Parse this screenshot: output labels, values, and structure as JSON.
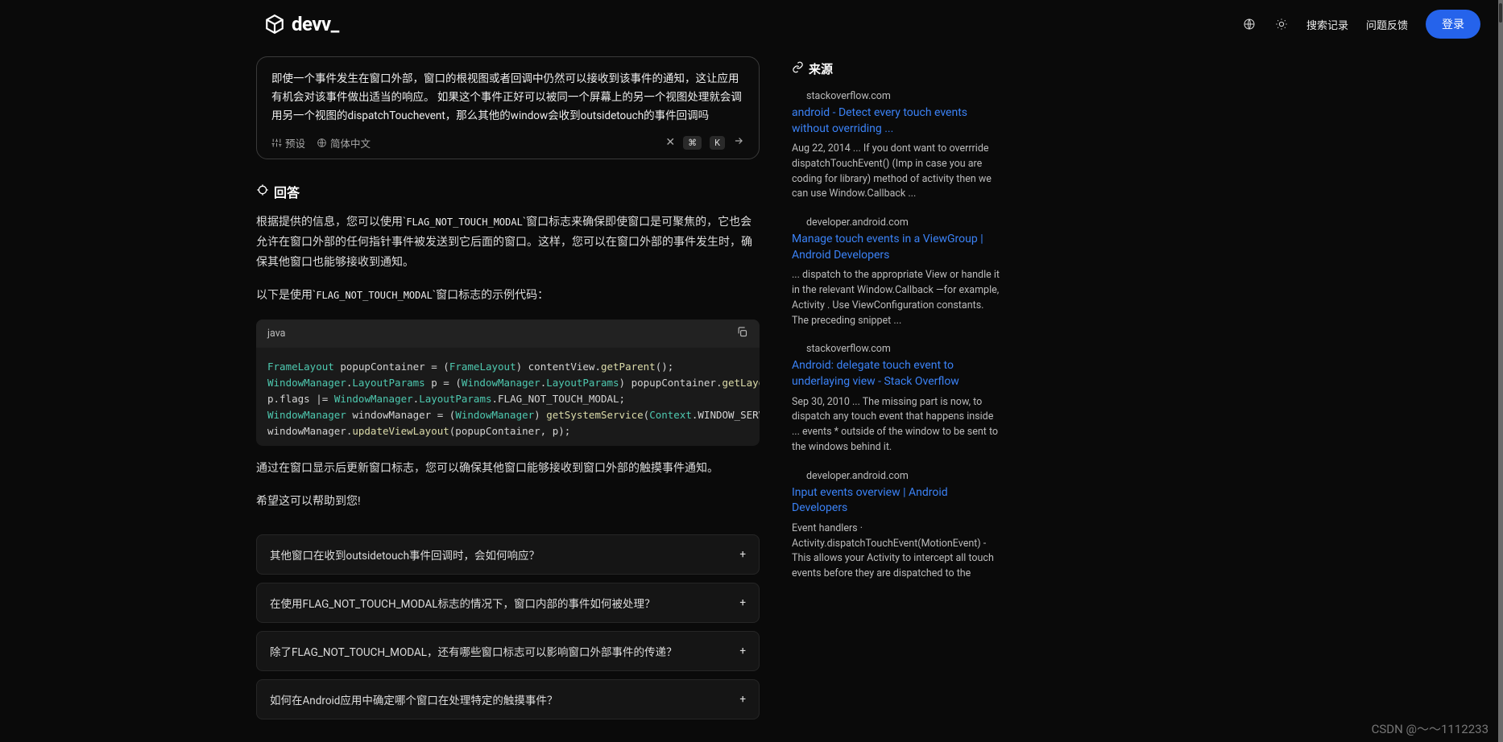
{
  "header": {
    "logo_text": "devv_",
    "nav": {
      "history": "搜索记录",
      "feedback": "问题反馈",
      "login": "登录"
    }
  },
  "query": {
    "text": "即使一个事件发生在窗口外部，窗口的根视图或者回调中仍然可以接收到该事件的通知，这让应用有机会对该事件做出适当的响应。 如果这个事件正好可以被同一个屏幕上的另一个视图处理就会调用另一个视图的dispatchTouchevent，那么其他的window会收到outsidetouch的事件回调吗",
    "preset": "预设",
    "lang": "简体中文",
    "kbd1": "⌘",
    "kbd2": "K"
  },
  "answer": {
    "heading": "回答",
    "p1_pre": "根据提供的信息，您可以使用`",
    "p1_code": "FLAG_NOT_TOUCH_MODAL",
    "p1_post": "`窗口标志来确保即使窗口是可聚焦的，它也会允许在窗口外部的任何指针事件被发送到它后面的窗口。这样，您可以在窗口外部的事件发生时，确保其他窗口也能够接收到通知。",
    "p2_pre": "以下是使用`",
    "p2_code": "FLAG_NOT_TOUCH_MODAL",
    "p2_post": "`窗口标志的示例代码：",
    "code_lang": "java",
    "p3": "通过在窗口显示后更新窗口标志，您可以确保其他窗口能够接收到窗口外部的触摸事件通知。",
    "p4": "希望这可以帮助到您!"
  },
  "code": {
    "l1a": "FrameLayout",
    "l1b": " popupContainer ",
    "l1c": "=",
    "l1d": " (",
    "l1e": "FrameLayout",
    "l1f": ") contentView.",
    "l1g": "getParent",
    "l1h": "();",
    "l2a": "WindowManager",
    "l2b": ".",
    "l2c": "LayoutParams",
    "l2d": " p ",
    "l2e": "=",
    "l2f": " (",
    "l2g": "WindowManager",
    "l2h": ".",
    "l2i": "LayoutParams",
    "l2j": ") popupContainer.",
    "l2k": "getLayoutParams",
    "l2l": "();",
    "l3a": "p.flags ",
    "l3b": "|=",
    "l3c": " ",
    "l3d": "WindowManager",
    "l3e": ".",
    "l3f": "LayoutParams",
    "l3g": ".FLAG_NOT_TOUCH_MODAL;",
    "l4a": "WindowManager",
    "l4b": " windowManager ",
    "l4c": "=",
    "l4d": " (",
    "l4e": "WindowManager",
    "l4f": ") ",
    "l4g": "getSystemService",
    "l4h": "(",
    "l4i": "Context",
    "l4j": ".WINDOW_SERVICE);",
    "l5a": "windowManager.",
    "l5b": "updateViewLayout",
    "l5c": "(popupContainer, p);"
  },
  "followups": [
    "其他窗口在收到outsidetouch事件回调时，会如何响应？",
    "在使用FLAG_NOT_TOUCH_MODAL标志的情况下，窗口内部的事件如何被处理？",
    "除了FLAG_NOT_TOUCH_MODAL，还有哪些窗口标志可以影响窗口外部事件的传递？",
    "如何在Android应用中确定哪个窗口在处理特定的触摸事件？"
  ],
  "sources": {
    "heading": "来源",
    "items": [
      {
        "domain": "stackoverflow.com",
        "title": "android - Detect every touch events without overriding ...",
        "snippet": "Aug 22, 2014 ... If you dont want to overrride dispatchTouchEvent() (Imp in case you are coding for library) method of activity then we can use Window.Callback ..."
      },
      {
        "domain": "developer.android.com",
        "title": "Manage touch events in a ViewGroup | Android Developers",
        "snippet": "... dispatch to the appropriate View or handle it in the relevant Window.Callback —for example, Activity . Use ViewConfiguration constants. The preceding snippet ..."
      },
      {
        "domain": "stackoverflow.com",
        "title": "Android: delegate touch event to underlaying view - Stack Overflow",
        "snippet": "Sep 30, 2010 ... The missing part is now, to dispatch any touch event that happens inside ... events * outside of the window to be sent to the windows behind it."
      },
      {
        "domain": "developer.android.com",
        "title": "Input events overview | Android Developers",
        "snippet": "Event handlers · Activity.dispatchTouchEvent(MotionEvent) - This allows your Activity to intercept all touch events before they are dispatched to the"
      }
    ]
  },
  "watermark": "CSDN @～～1112233"
}
